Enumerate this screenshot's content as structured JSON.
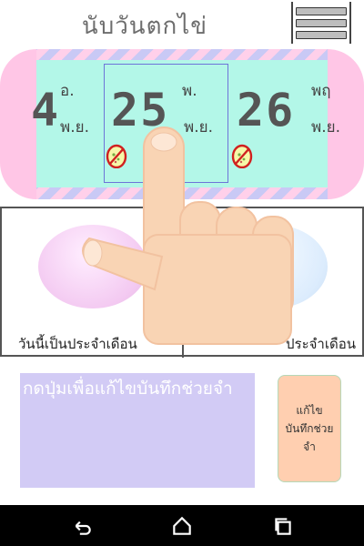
{
  "app": {
    "title": "นับวันตกไข่"
  },
  "calendar": {
    "days": [
      {
        "number": "4",
        "day_abbr": "อ.",
        "month_abbr": "พ.ย."
      },
      {
        "number": "25",
        "day_abbr": "พ.",
        "month_abbr": "พ.ย.",
        "selected": true,
        "no_egg": true
      },
      {
        "number": "26",
        "day_abbr": "พฤ",
        "month_abbr": "พ.ย.",
        "no_egg": true
      }
    ]
  },
  "panel": {
    "left_label": "วันนี้เป็นประจำเดือน",
    "right_label": "ประจำเดือน"
  },
  "note": {
    "placeholder": "กดปุ่มเพื่อแก้ไขบันทึกช่วยจำ"
  },
  "edit_button": {
    "label": "แก้ไข บันทึกช่วยจำ"
  },
  "colors": {
    "accent_pink": "#ffc6e6",
    "calendar_face": "#b3f7e8",
    "note_bg": "#d2cbf5",
    "edit_button_bg": "#ffcfb0"
  },
  "icons": {
    "menu": "hamburger-icon",
    "no_egg": "no-egg-icon",
    "back": "back-icon",
    "home": "home-icon",
    "recents": "recents-icon"
  }
}
